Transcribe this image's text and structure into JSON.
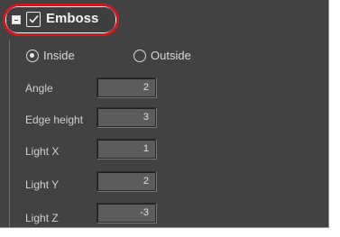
{
  "section": {
    "title": "Emboss",
    "checked": true
  },
  "position_options": [
    {
      "label": "Inside",
      "selected": true
    },
    {
      "label": "Outside",
      "selected": false
    }
  ],
  "fields": [
    {
      "label": "Angle",
      "value": "2"
    },
    {
      "label": "Edge height",
      "value": "3"
    },
    {
      "label": "Light X",
      "value": "1"
    },
    {
      "label": "Light Y",
      "value": "2"
    },
    {
      "label": "Light Z",
      "value": "-3"
    }
  ],
  "colors": {
    "panel": "#424242",
    "highlight_ring": "#d01820"
  }
}
